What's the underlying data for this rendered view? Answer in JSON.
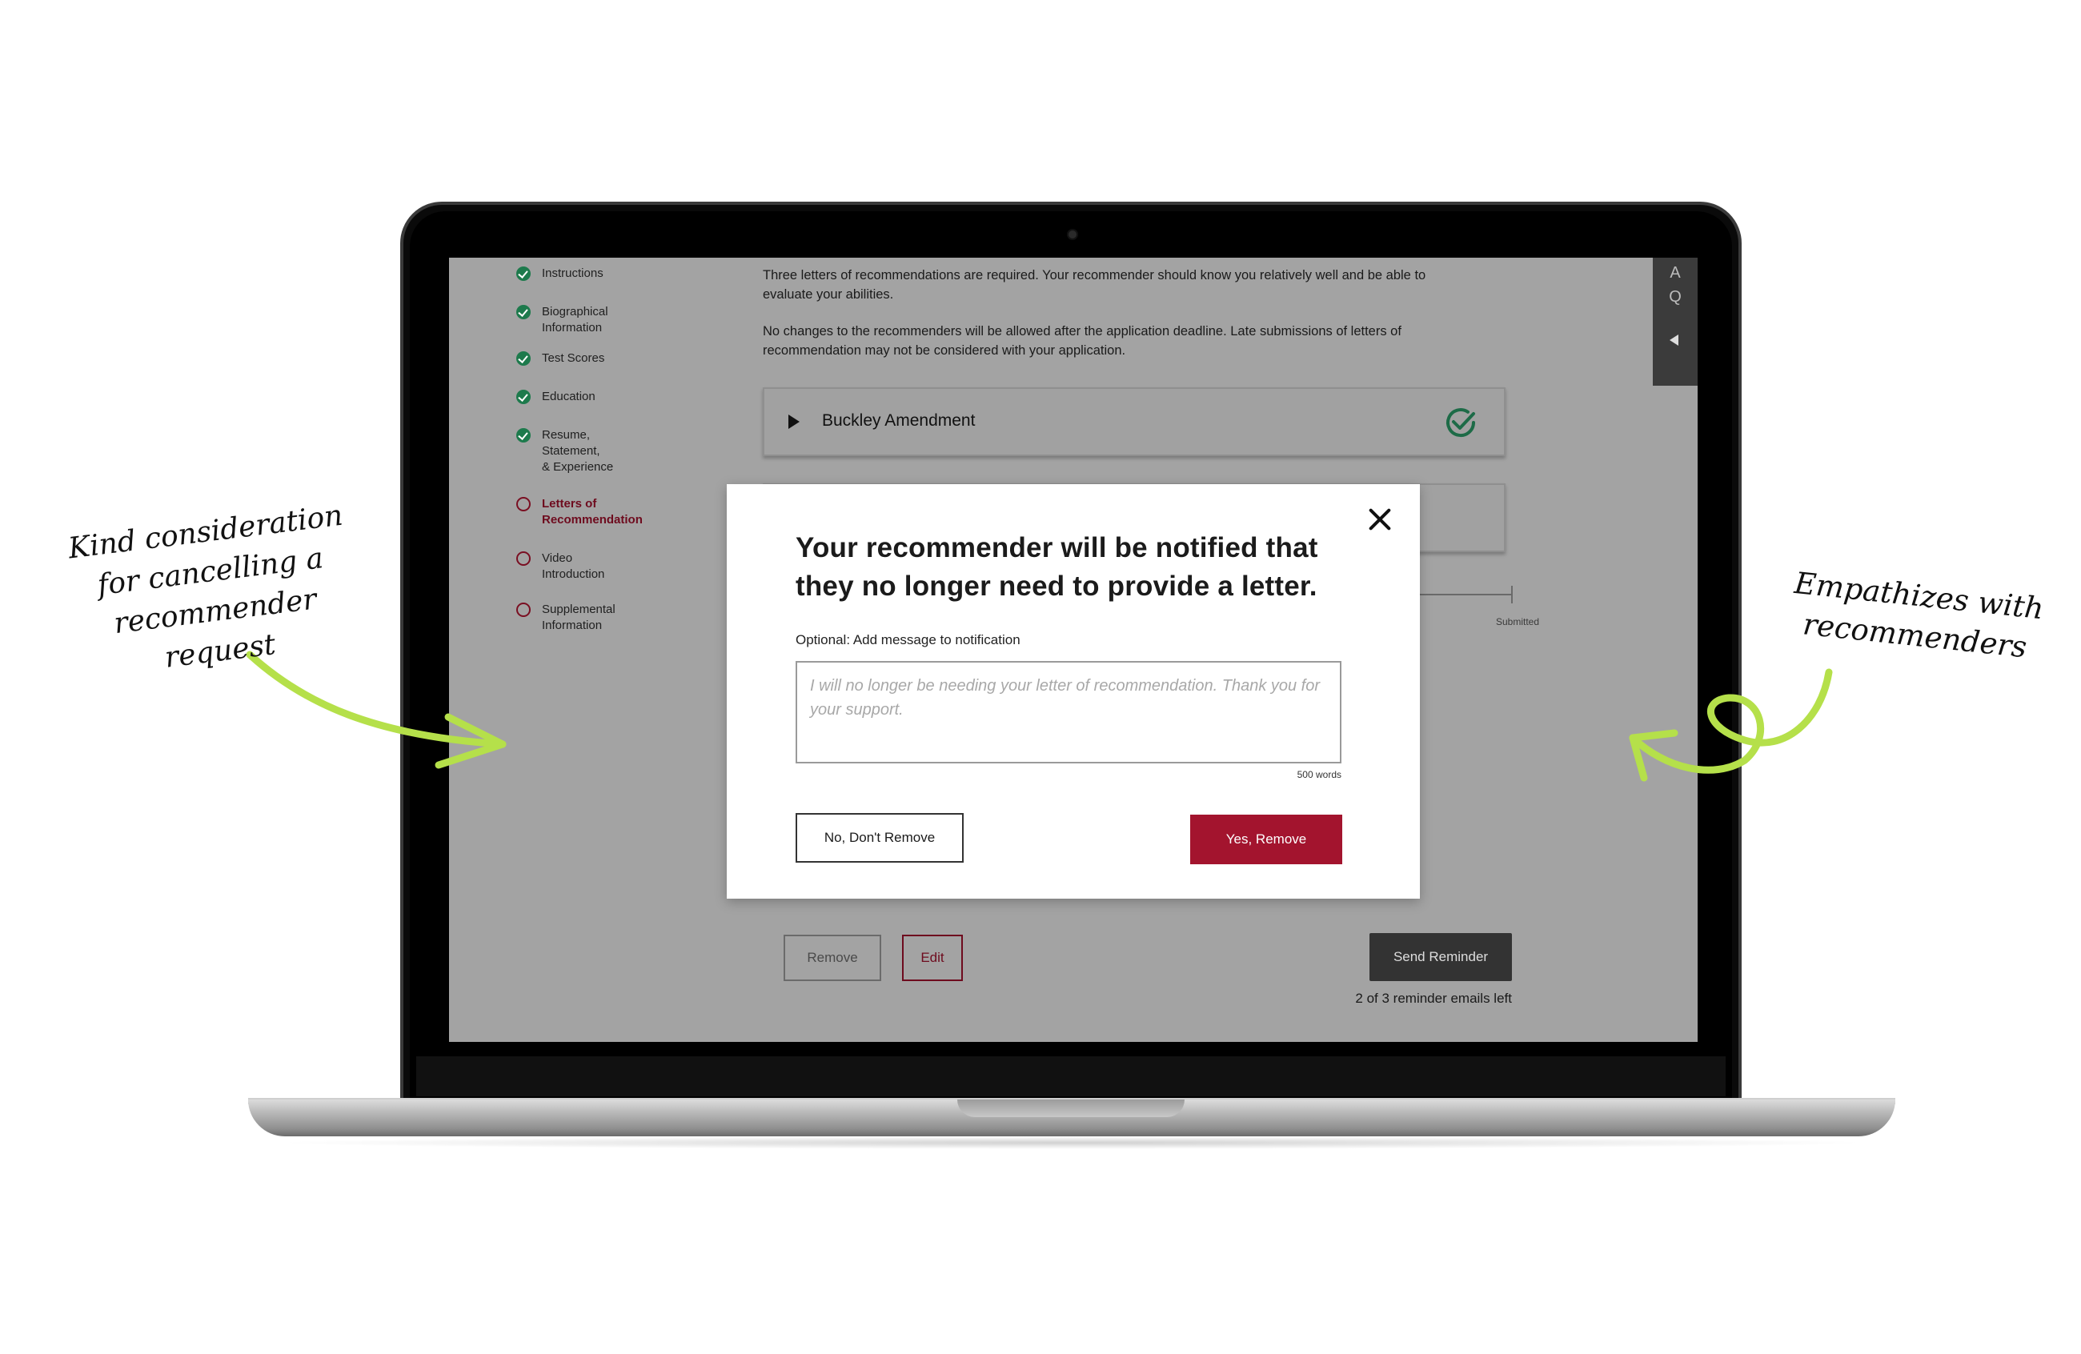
{
  "sidebar": {
    "items": [
      {
        "label": "Instructions",
        "status": "complete"
      },
      {
        "label": "Biographical\nInformation",
        "status": "complete"
      },
      {
        "label": "Test Scores",
        "status": "complete"
      },
      {
        "label": "Education",
        "status": "complete"
      },
      {
        "label": "Resume,\nStatement,\n& Experience",
        "status": "complete"
      },
      {
        "label": "Letters of\nRecommendation",
        "status": "current"
      },
      {
        "label": "Video\nIntroduction",
        "status": "incomplete"
      },
      {
        "label": "Supplemental\nInformation",
        "status": "incomplete"
      }
    ]
  },
  "intro": {
    "paragraph1": "Three letters of recommendations are required. Your recommender should know you relatively well and be able to evaluate your abilities.",
    "paragraph2": "No changes to the recommenders will be allowed after the application deadline. Late submissions of letters of recommendation may not be considered with your application."
  },
  "accordion": {
    "title": "Buckley Amendment",
    "status_icon": "check-circle-icon"
  },
  "progress": {
    "submitted_label": "Submitted"
  },
  "actions": {
    "remove_label": "Remove",
    "edit_label": "Edit",
    "send_reminder_label": "Send Reminder",
    "reminders_left": "2 of 3 reminder emails left"
  },
  "side_tab": {
    "letter1": "A",
    "letter2": "Q"
  },
  "modal": {
    "title": "Your recommender will be notified that they no longer need to provide a letter.",
    "message_label": "Optional: Add message to notification",
    "message_placeholder": "I will no longer be needing your letter of recommendation. Thank you for your support.",
    "word_limit": "500 words",
    "cancel_label": "No, Don't Remove",
    "confirm_label": "Yes, Remove"
  },
  "annotations": {
    "left": "Kind consideration for cancelling a recommender request",
    "right": "Empathizes with recommenders"
  },
  "colors": {
    "brand": "#a3142e",
    "complete": "#1d7a4c",
    "arrow": "#b5e04a",
    "overlay": "#a3a3a3"
  }
}
